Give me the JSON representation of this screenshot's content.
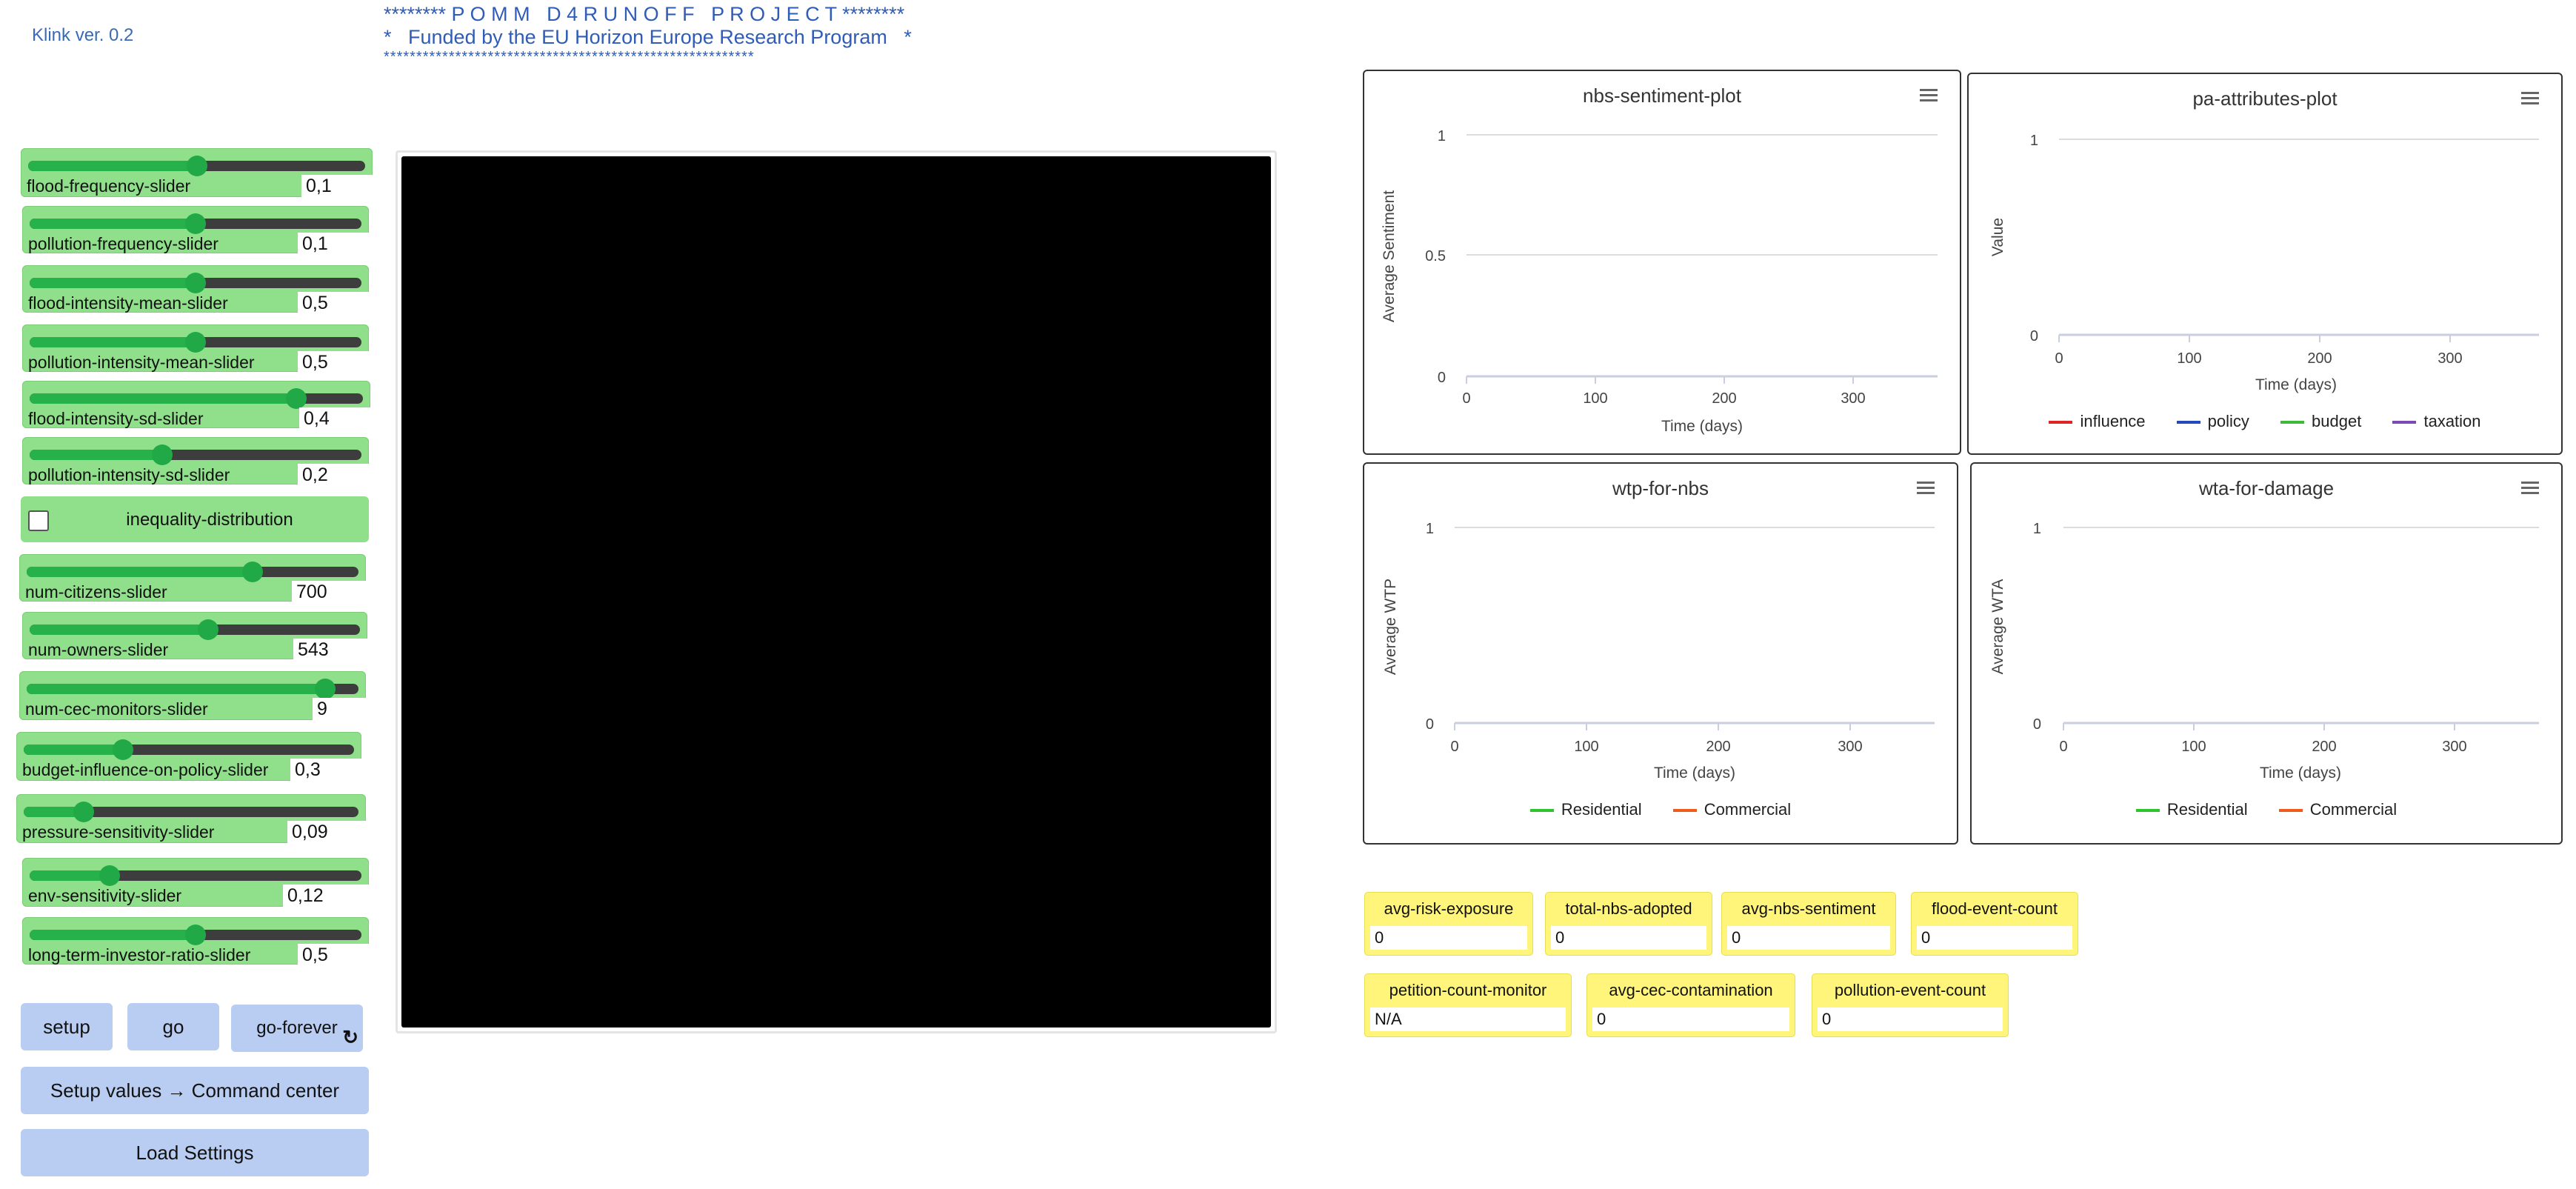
{
  "app": {
    "version": "Klink ver. 0.2",
    "banner_line1": "******** P O M M   D 4 R U N O F F   P R O J E C T ********",
    "banner_line2": "*   Funded by the EU Horizon Europe Research Program   *",
    "banner_line3": "*********************************************************"
  },
  "sliders": [
    {
      "label": "flood-frequency-slider",
      "value": "0,1",
      "fraction": 0.5
    },
    {
      "label": "pollution-frequency-slider",
      "value": "0,1",
      "fraction": 0.5
    },
    {
      "label": "flood-intensity-mean-slider",
      "value": "0,5",
      "fraction": 0.5
    },
    {
      "label": "pollution-intensity-mean-slider",
      "value": "0,5",
      "fraction": 0.5
    },
    {
      "label": "flood-intensity-sd-slider",
      "value": "0,4",
      "fraction": 0.8
    },
    {
      "label": "pollution-intensity-sd-slider",
      "value": "0,2",
      "fraction": 0.4
    },
    {
      "label": "num-citizens-slider",
      "value": "700",
      "fraction": 0.68
    },
    {
      "label": "num-owners-slider",
      "value": "543",
      "fraction": 0.54
    },
    {
      "label": "num-cec-monitors-slider",
      "value": "9",
      "fraction": 0.9
    },
    {
      "label": "budget-influence-on-policy-slider",
      "value": "0,3",
      "fraction": 0.3
    },
    {
      "label": "pressure-sensitivity-slider",
      "value": "0,09",
      "fraction": 0.18
    },
    {
      "label": "env-sensitivity-slider",
      "value": "0,12",
      "fraction": 0.24
    },
    {
      "label": "long-term-investor-ratio-slider",
      "value": "0,5",
      "fraction": 0.5
    }
  ],
  "switch": {
    "label": "inequality-distribution",
    "checked": false
  },
  "buttons": {
    "setup": "setup",
    "go": "go",
    "go_forever": "go-forever",
    "setup_values": "Setup values → Command center",
    "load_settings": "Load Settings"
  },
  "plots": {
    "nbs_sentiment": {
      "title": "nbs-sentiment-plot",
      "ylabel": "Average Sentiment",
      "xlabel": "Time (days)",
      "yticks": [
        "1",
        "0.5",
        "0"
      ],
      "xticks": [
        "0",
        "100",
        "200",
        "300"
      ]
    },
    "pa_attributes": {
      "title": "pa-attributes-plot",
      "ylabel": "Value",
      "xlabel": "Time (days)",
      "yticks": [
        "1",
        "0"
      ],
      "xticks": [
        "0",
        "100",
        "200",
        "300"
      ],
      "legend": [
        {
          "name": "influence",
          "color": "#e02424"
        },
        {
          "name": "policy",
          "color": "#2449b8"
        },
        {
          "name": "budget",
          "color": "#3cba3c"
        },
        {
          "name": "taxation",
          "color": "#7a4bb5"
        }
      ]
    },
    "wtp_for_nbs": {
      "title": "wtp-for-nbs",
      "ylabel": "Average WTP",
      "xlabel": "Time (days)",
      "yticks": [
        "1",
        "0"
      ],
      "xticks": [
        "0",
        "100",
        "200",
        "300"
      ],
      "legend": [
        {
          "name": "Residential",
          "color": "#2ec42e"
        },
        {
          "name": "Commercial",
          "color": "#f05a1c"
        }
      ]
    },
    "wta_for_damage": {
      "title": "wta-for-damage",
      "ylabel": "Average WTA",
      "xlabel": "Time (days)",
      "yticks": [
        "1",
        "0"
      ],
      "xticks": [
        "0",
        "100",
        "200",
        "300"
      ],
      "legend": [
        {
          "name": "Residential",
          "color": "#2ec42e"
        },
        {
          "name": "Commercial",
          "color": "#f05a1c"
        }
      ]
    }
  },
  "monitors": [
    {
      "label": "avg-risk-exposure",
      "value": "0"
    },
    {
      "label": "total-nbs-adopted",
      "value": "0"
    },
    {
      "label": "avg-nbs-sentiment",
      "value": "0"
    },
    {
      "label": "flood-event-count",
      "value": "0"
    },
    {
      "label": "petition-count-monitor",
      "value": "N/A"
    },
    {
      "label": "avg-cec-contamination",
      "value": "0"
    },
    {
      "label": "pollution-event-count",
      "value": "0"
    }
  ]
}
